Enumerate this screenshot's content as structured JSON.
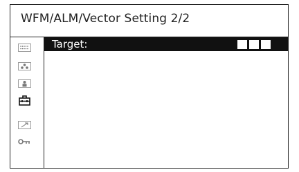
{
  "header": {
    "title": "WFM/ALM/Vector Setting 2/2"
  },
  "sidebar": {
    "items": [
      {
        "icon": "dots-grid-icon"
      },
      {
        "icon": "three-dots-icon"
      },
      {
        "icon": "person-icon"
      },
      {
        "icon": "toolbox-icon"
      },
      {
        "icon": "arrow-diagonal-icon"
      },
      {
        "icon": "key-icon"
      }
    ]
  },
  "main": {
    "rows": [
      {
        "label": "Target:",
        "value_blocks": 3
      }
    ]
  },
  "colors": {
    "selected_row": "#111111",
    "text": "#222222"
  }
}
